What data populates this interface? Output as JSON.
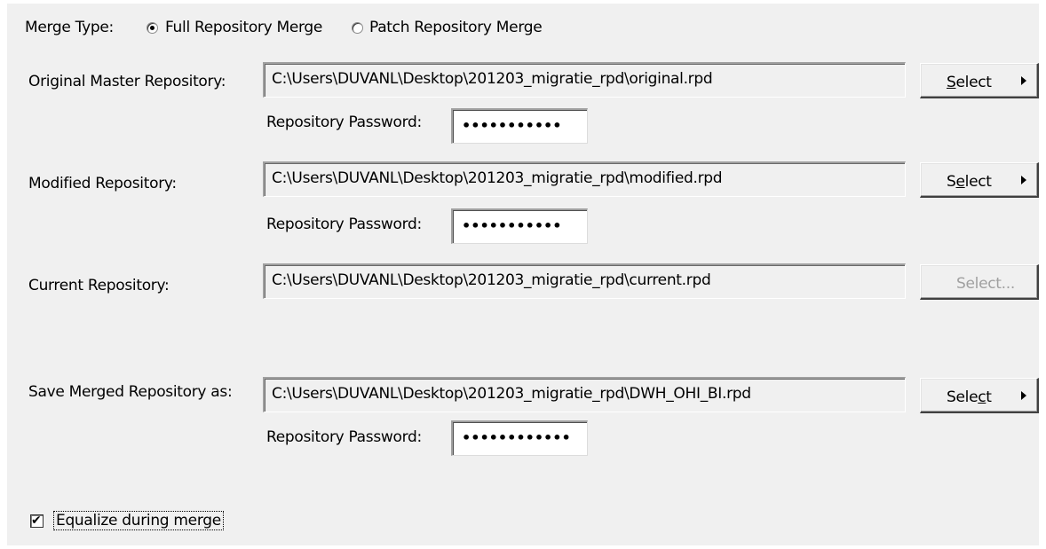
{
  "merge_type": {
    "label": "Merge Type:",
    "options": [
      {
        "label": "Full Repository Merge",
        "selected": true
      },
      {
        "label": "Patch Repository Merge",
        "selected": false
      }
    ]
  },
  "original": {
    "label": "Original Master Repository:",
    "path": "C:\\Users\\DUVANL\\Desktop\\201203_migratie_rpd\\original.rpd",
    "password_label": "Repository Password:",
    "password": "•••••••••••",
    "select_label": "Select"
  },
  "modified": {
    "label": "Modified Repository:",
    "path": "C:\\Users\\DUVANL\\Desktop\\201203_migratie_rpd\\modified.rpd",
    "password_label": "Repository Password:",
    "password": "•••••••••••",
    "select_label": "Select"
  },
  "current": {
    "label": "Current Repository:",
    "path": "C:\\Users\\DUVANL\\Desktop\\201203_migratie_rpd\\current.rpd",
    "select_label": "Select..."
  },
  "save_as": {
    "label": "Save Merged Repository as:",
    "path": "C:\\Users\\DUVANL\\Desktop\\201203_migratie_rpd\\DWH_OHI_BI.rpd",
    "password_label": "Repository Password:",
    "password": "••••••••••••",
    "select_label": "Select"
  },
  "equalize": {
    "label": "Equalize during merge",
    "checked": true
  }
}
